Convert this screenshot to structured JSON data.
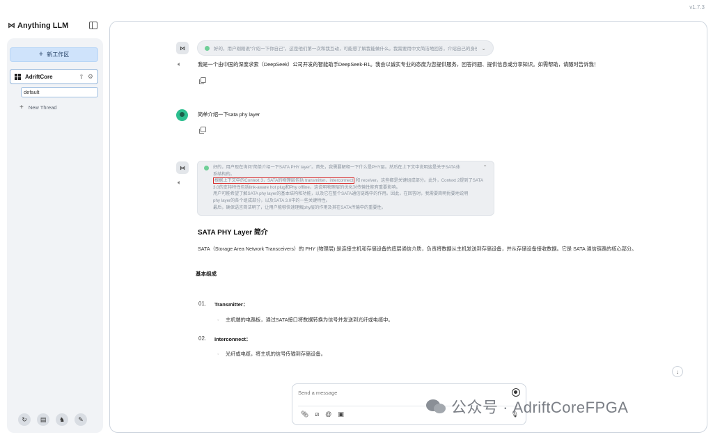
{
  "app": {
    "version": "v1.7.3",
    "logo_mark": "⋈",
    "name": "Anything LLM"
  },
  "sidebar": {
    "new_workspace_label": "新工作区",
    "workspace": {
      "name": "AdriftCore"
    },
    "threads": [
      {
        "name": "default"
      }
    ],
    "new_thread_label": "New Thread",
    "footer_icons": [
      "support-icon",
      "docs-icon",
      "community-icon",
      "settings-icon"
    ]
  },
  "chat": {
    "messages": [
      {
        "role": "assistant",
        "thinking": "好的，用户刚刚说“介绍一下你自己”，这是他们第一次和我互动，可能想了解我能做什么。我需要用中文简洁地回答，介绍自己的身份和功能……",
        "text": "我是一个由中国的深度求索（DeepSeek）公司开发的智能助手DeepSeek-R1。我会以诚实专业的态度为您提供服务，回答问题、提供信息或分享知识。如需帮助，请随时告诉我！"
      },
      {
        "role": "user",
        "text": "简单介绍一下sata phy layer"
      },
      {
        "role": "assistant",
        "thinking_lines": [
          "好的，用户现在询问“简单介绍一下SATA PHY layer”。首先，我需要解释一下什么是PHY层。然后在上下文中说明这是关于SATA体",
          "系结构的。",
          "根据上下文中的Context 3，SATA的物理层包括 transmitter、interconnect",
          "和 receiver。这些都是关键组成部分。此外，Context 2提到了SATA 3.0的支持特性包括link-aware hot plug和Phy offline，这说明物理层的优化对传输性能有重要影响。",
          "用户可能希望了解SATA phy layer的基本结构和功能，以及它在整个SATA通信链路中的作用。因此，在回答时，我需要简明扼要地说明",
          "phy layer的各个组成部分，以及SATA 3.0中的一些关键特性。",
          "最后，确保语言简洁明了，让用户能够快速理解phy层的作用及其在SATA传输中的重要性。"
        ],
        "title": "SATA PHY Layer 简介",
        "paragraph": "SATA（Storage Area Network Transceivers）的 PHY (物理层) 是连接主机和存储设备的底层通信介质，负责将数据从主机发送到存储设备，并从存储设备接收数据。它是 SATA 通信链路的核心部分。",
        "subheading": "基本组成",
        "list": [
          {
            "num": "01.",
            "title": "Transmitter：",
            "desc": "主机端的电路板，通过SATA接口将数据转换为信号并发送到光纤或电缆中。"
          },
          {
            "num": "02.",
            "title": "Interconnect：",
            "desc": "光纤或电缆，将主机的信号传输到存储设备。"
          }
        ]
      }
    ]
  },
  "composer": {
    "placeholder": "Send a message"
  },
  "watermark": {
    "text": "公众号 · AdriftCoreFPGA"
  }
}
